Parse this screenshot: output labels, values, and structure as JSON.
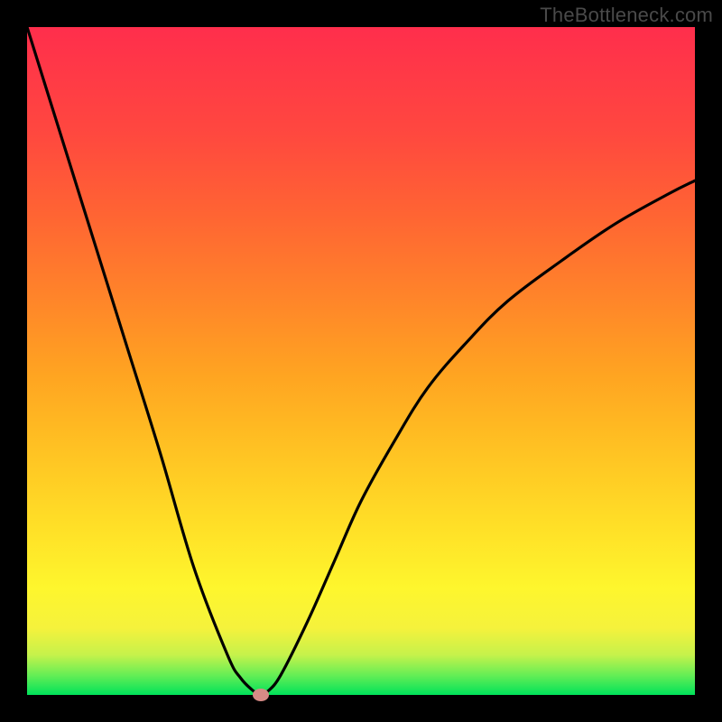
{
  "watermark": "TheBottleneck.com",
  "chart_data": {
    "type": "line",
    "title": "",
    "xlabel": "",
    "ylabel": "",
    "xlim": [
      0,
      100
    ],
    "ylim": [
      0,
      100
    ],
    "grid": false,
    "legend": false,
    "series": [
      {
        "name": "curve",
        "x": [
          0,
          5,
          10,
          15,
          20,
          25,
          30,
          32,
          34,
          35,
          36,
          38,
          42,
          46,
          50,
          55,
          60,
          66,
          72,
          80,
          88,
          96,
          100
        ],
        "values": [
          100,
          84,
          68,
          52,
          36,
          19,
          6,
          2.5,
          0.5,
          0,
          0.5,
          3,
          11,
          20,
          29,
          38,
          46,
          53,
          59,
          65,
          70.5,
          75,
          77
        ]
      }
    ],
    "marker": {
      "x": 35,
      "y": 0,
      "color": "#d78b86"
    },
    "colors": {
      "background_top": "#ff2e4c",
      "background_bottom": "#00e25a",
      "curve": "#000000",
      "frame": "#000000"
    }
  }
}
